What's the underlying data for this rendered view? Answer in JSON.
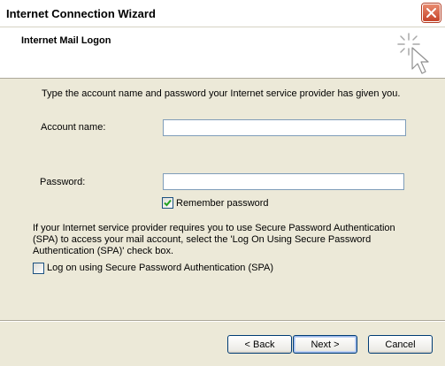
{
  "window": {
    "title": "Internet Connection Wizard"
  },
  "header": {
    "title": "Internet Mail Logon"
  },
  "form": {
    "intro": "Type the account name and password your Internet service provider has given you.",
    "account_label": "Account name:",
    "account_value": "",
    "password_label": "Password:",
    "password_value": "",
    "remember_label": "Remember password",
    "remember_checked": true,
    "spa_info": "If your Internet service provider requires you to use Secure Password Authentication (SPA) to access your mail account, select the 'Log On Using Secure Password Authentication (SPA)' check box.",
    "spa_label": "Log on using Secure Password Authentication (SPA)",
    "spa_checked": false
  },
  "buttons": {
    "back": "< Back",
    "next": "Next >",
    "cancel": "Cancel"
  }
}
